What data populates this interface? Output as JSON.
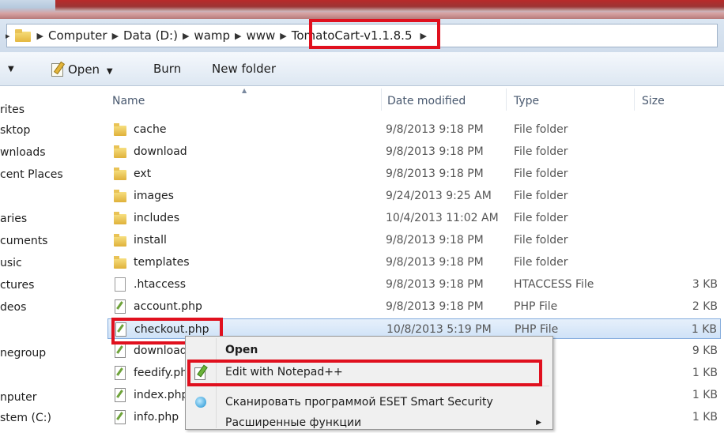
{
  "address_bar": {
    "crumbs": [
      "Computer",
      "Data (D:)",
      "wamp",
      "www",
      "TomatoCart-v1.1.8.5"
    ]
  },
  "toolbar": {
    "open_label": "Open",
    "burn_label": "Burn",
    "new_folder_label": "New folder"
  },
  "nav": {
    "items": [
      "rites",
      "sktop",
      "wnloads",
      "cent Places",
      "aries",
      "cuments",
      "usic",
      "ctures",
      "deos",
      "negroup",
      "nputer",
      "stem (C:)"
    ]
  },
  "columns": {
    "name": "Name",
    "date": "Date modified",
    "type": "Type",
    "size": "Size"
  },
  "files": [
    {
      "name": "cache",
      "date": "9/8/2013 9:18 PM",
      "type": "File folder",
      "size": "",
      "icon": "folder-icon"
    },
    {
      "name": "download",
      "date": "9/8/2013 9:18 PM",
      "type": "File folder",
      "size": "",
      "icon": "folder-icon"
    },
    {
      "name": "ext",
      "date": "9/8/2013 9:18 PM",
      "type": "File folder",
      "size": "",
      "icon": "folder-icon"
    },
    {
      "name": "images",
      "date": "9/24/2013 9:25 AM",
      "type": "File folder",
      "size": "",
      "icon": "folder-icon"
    },
    {
      "name": "includes",
      "date": "10/4/2013 11:02 AM",
      "type": "File folder",
      "size": "",
      "icon": "folder-icon"
    },
    {
      "name": "install",
      "date": "9/8/2013 9:18 PM",
      "type": "File folder",
      "size": "",
      "icon": "folder-icon"
    },
    {
      "name": "templates",
      "date": "9/8/2013 9:18 PM",
      "type": "File folder",
      "size": "",
      "icon": "folder-icon"
    },
    {
      "name": ".htaccess",
      "date": "9/8/2013 9:18 PM",
      "type": "HTACCESS File",
      "size": "3 KB",
      "icon": "file-icon"
    },
    {
      "name": "account.php",
      "date": "9/8/2013 9:18 PM",
      "type": "PHP File",
      "size": "2 KB",
      "icon": "php-file-icon"
    },
    {
      "name": "checkout.php",
      "date": "10/8/2013 5:19 PM",
      "type": "PHP File",
      "size": "1 KB",
      "icon": "php-file-icon"
    },
    {
      "name": "download",
      "date": "",
      "type": "ile",
      "size": "9 KB",
      "icon": "php-file-icon"
    },
    {
      "name": "feedify.ph",
      "date": "",
      "type": "ile",
      "size": "1 KB",
      "icon": "php-file-icon"
    },
    {
      "name": "index.php",
      "date": "",
      "type": "ile",
      "size": "1 KB",
      "icon": "php-file-icon"
    },
    {
      "name": "info.php",
      "date": "",
      "type": "ile",
      "size": "1 KB",
      "icon": "php-file-icon"
    }
  ],
  "context_menu": {
    "open": "Open",
    "edit_notepad": "Edit with Notepad++",
    "eset_scan": "Сканировать программой ESET Smart Security",
    "advanced": "Расширенные функции"
  },
  "colors": {
    "highlight_red": "#e0101e",
    "selection_blue": "#cfe2f7"
  }
}
